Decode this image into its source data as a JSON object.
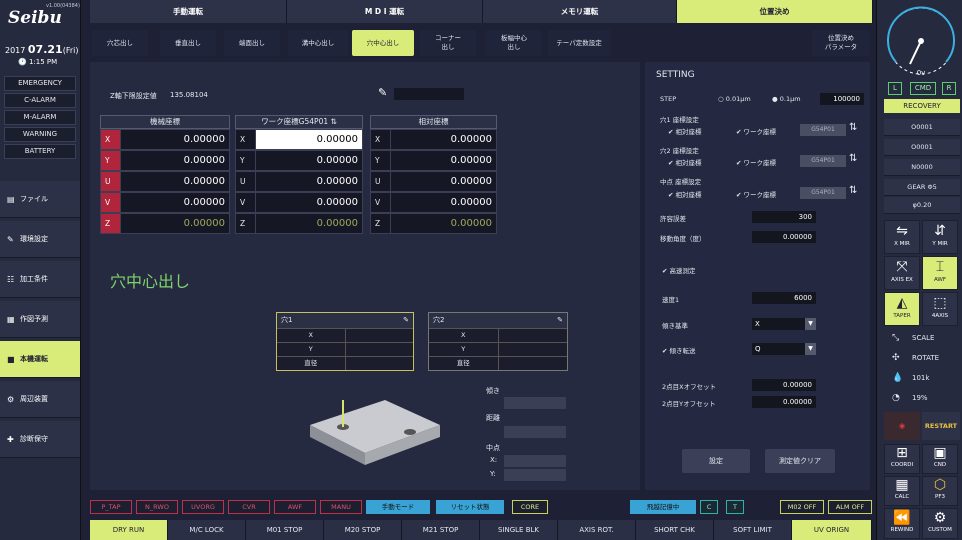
{
  "brand": {
    "logo": "Seibu",
    "version": "v1.00(04384)",
    "date_year": "2017",
    "date_day": "07.21",
    "date_weekday": "(Fri)",
    "time": "1:15 PM"
  },
  "alarms": [
    "EMERGENCY",
    "C-ALARM",
    "M-ALARM",
    "WARNING",
    "BATTERY"
  ],
  "sidebar": [
    {
      "label": "ファイル",
      "icon": "file-icon"
    },
    {
      "label": "環境設定",
      "icon": "wrench-icon"
    },
    {
      "label": "加工条件",
      "icon": "sliders-icon"
    },
    {
      "label": "作図予測",
      "icon": "draw-icon"
    },
    {
      "label": "本機運転",
      "icon": "machine-icon",
      "active": true
    },
    {
      "label": "周辺装置",
      "icon": "peripheral-icon"
    },
    {
      "label": "診断保守",
      "icon": "diagnosis-icon"
    }
  ],
  "top_tabs": [
    {
      "label": "手動運転"
    },
    {
      "label": "M D I 運転"
    },
    {
      "label": "メモリ運転"
    },
    {
      "label": "位置決め",
      "active": true
    }
  ],
  "sub_tabs": [
    {
      "label": "穴芯出し"
    },
    {
      "label": "垂直出し"
    },
    {
      "label": "端面出し"
    },
    {
      "label": "溝中心出し"
    },
    {
      "label": "穴中心出し",
      "active": true
    },
    {
      "label": "コーナー\n出し"
    },
    {
      "label": "板幅中心\n出し"
    },
    {
      "label": "テーパ定数設定"
    },
    {
      "label": "位置決め\nパラメータ"
    }
  ],
  "main": {
    "z_limit_label": "Z軸下限設定値",
    "z_limit_value": "135.08104",
    "section_title": "穴中心出し",
    "machine": {
      "title": "機械座標",
      "rows": [
        [
          "X",
          "0.00000"
        ],
        [
          "Y",
          "0.00000"
        ],
        [
          "U",
          "0.00000"
        ],
        [
          "V",
          "0.00000"
        ],
        [
          "Z",
          "0.00000"
        ]
      ]
    },
    "work": {
      "title": "ワーク座標G54P01",
      "rows": [
        [
          "X",
          "0.00000"
        ],
        [
          "Y",
          "0.00000"
        ],
        [
          "U",
          "0.00000"
        ],
        [
          "V",
          "0.00000"
        ],
        [
          "Z",
          "0.00000"
        ]
      ]
    },
    "relative": {
      "title": "相対座標",
      "rows": [
        [
          "X",
          "0.00000"
        ],
        [
          "Y",
          "0.00000"
        ],
        [
          "U",
          "0.00000"
        ],
        [
          "V",
          "0.00000"
        ],
        [
          "Z",
          "0.00000"
        ]
      ]
    },
    "hole1": {
      "title": "穴1",
      "rows": [
        "X",
        "Y",
        "直径"
      ]
    },
    "hole2": {
      "title": "穴2",
      "rows": [
        "X",
        "Y",
        "直径"
      ]
    },
    "result_labels": {
      "incline": "傾き",
      "distance": "距離",
      "midpoint": "中点",
      "x": "X:",
      "y": "Y:"
    }
  },
  "setting": {
    "title": "SETTING",
    "step_label": "STEP",
    "step_opts": [
      "0.01μm",
      "0.1μm"
    ],
    "step_value": "100000",
    "hole1_label": "穴1 座標設定",
    "hole2_label": "穴2 座標設定",
    "mid_label": "中点 座標設定",
    "rel_coord": "相対座標",
    "work_coord": "ワーク座標",
    "coord_btn": "G54P01",
    "tolerance_label": "許容誤差",
    "tolerance_value": "300",
    "angle_label": "移動角度（度）",
    "angle_value": "0.00000",
    "fast_label": "高速測定",
    "speed_label": "速度1",
    "speed_value": "6000",
    "incline_base_label": "傾き基準",
    "incline_base_value": "X",
    "incline_trans_label": "傾き転送",
    "incline_trans_value": "Q",
    "offset_x_label": "2点目Xオフセット",
    "offset_x_value": "0.00000",
    "offset_y_label": "2点目Yオフセット",
    "offset_y_value": "0.00000",
    "set_btn": "設定",
    "clear_btn": "測定値クリア"
  },
  "status_buttons": [
    {
      "label": "P_TAP",
      "style": "red"
    },
    {
      "label": "N_RWO",
      "style": "red"
    },
    {
      "label": "UVORG",
      "style": "red"
    },
    {
      "label": "CVR",
      "style": "red"
    },
    {
      "label": "AWF",
      "style": "red"
    },
    {
      "label": "MANU",
      "style": "red"
    },
    {
      "label": "手動モード",
      "style": "blue"
    },
    {
      "label": "リセット状態",
      "style": "blue"
    },
    {
      "label": "CORE",
      "style": "yel"
    },
    {
      "label": "飛越記億中",
      "style": "blue"
    },
    {
      "label": "C",
      "style": "teal"
    },
    {
      "label": "T",
      "style": "teal"
    },
    {
      "label": "M02 OFF",
      "style": "yel"
    },
    {
      "label": "ALM OFF",
      "style": "yel"
    }
  ],
  "bottom_bar": [
    {
      "label": "DRY RUN",
      "active": true
    },
    {
      "label": "M/C LOCK"
    },
    {
      "label": "M01 STOP"
    },
    {
      "label": "M20 STOP"
    },
    {
      "label": "M21 STOP"
    },
    {
      "label": "SINGLE BLK"
    },
    {
      "label": "AXIS ROT."
    },
    {
      "label": "SHORT CHK"
    },
    {
      "label": "SOFT LIMIT"
    },
    {
      "label": "UV ORIGN",
      "active": true
    }
  ],
  "right": {
    "gauge_label": "0v",
    "mode_buttons": [
      "L",
      "CMD",
      "R"
    ],
    "recovery": "RECOVERY",
    "info": [
      "O0001",
      "O0001",
      "N0000",
      "GEAR Φ5",
      "φ0.20"
    ],
    "icons": [
      {
        "label": "X MIR",
        "icon": "x-mirror-icon"
      },
      {
        "label": "Y MIR",
        "icon": "y-mirror-icon"
      },
      {
        "label": "AXIS EX",
        "icon": "axis-exchange-icon"
      },
      {
        "label": "AWF",
        "icon": "awf-icon",
        "active": true
      },
      {
        "label": "TAPER",
        "icon": "taper-icon",
        "active": true
      },
      {
        "label": "4AXIS",
        "icon": "four-axis-icon"
      }
    ],
    "scale": "SCALE",
    "rotate": "ROTATE",
    "drop_value": "101k",
    "water_value": "19%",
    "restart": "RESTART",
    "bottom_icons": [
      {
        "label": "COORDI",
        "icon": "coordinate-icon"
      },
      {
        "label": "CND",
        "icon": "condition-icon"
      },
      {
        "label": "CALC",
        "icon": "calculator-icon"
      },
      {
        "label": "PF3",
        "icon": "pf3-icon"
      },
      {
        "label": "REWIND",
        "icon": "rewind-icon"
      },
      {
        "label": "CUSTOM",
        "icon": "custom-icon"
      }
    ]
  },
  "colors": {
    "accent": "#d9ec7a",
    "alarm_red": "#b0243c",
    "bg": "#1e2135"
  }
}
